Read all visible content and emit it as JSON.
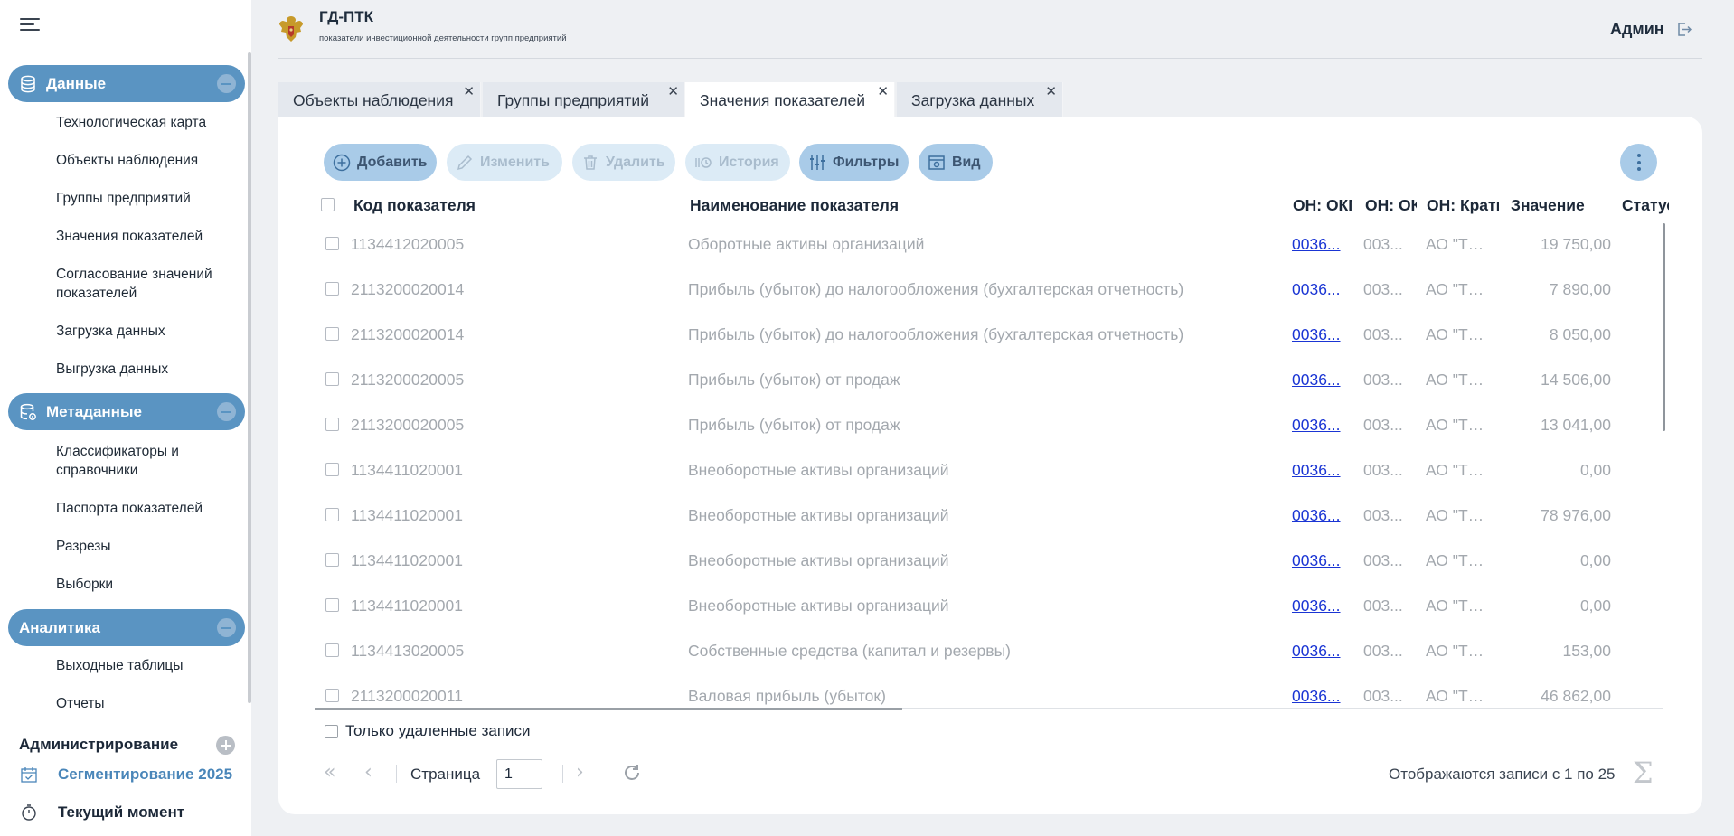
{
  "app": {
    "title": "ГД-ПТК",
    "subtitle": "показатели инвестиционной деятельности групп предприятий",
    "user": "Админ"
  },
  "sidebar": {
    "sections": [
      {
        "label": "Данные",
        "icon": "database-icon",
        "items": [
          "Технологическая карта",
          "Объекты наблюдения",
          "Группы предприятий",
          "Значения показателей",
          "Согласование значений показателей",
          "Загрузка данных",
          "Выгрузка данных"
        ]
      },
      {
        "label": "Метаданные",
        "icon": "database-settings-icon",
        "items": [
          "Классификаторы и справочники",
          "Паспорта показателей",
          "Разрезы",
          "Выборки"
        ]
      },
      {
        "label": "Аналитика",
        "icon": "",
        "items": [
          "Выходные таблицы",
          "Отчеты"
        ]
      }
    ],
    "admin_label": "Администрирование",
    "segment_label": "Сегментирование 2025",
    "now_label": "Текущий момент"
  },
  "tabs": [
    {
      "label": "Объекты наблюдения",
      "active": false
    },
    {
      "label": "Группы предприятий",
      "active": false
    },
    {
      "label": "Значения показателей",
      "active": true
    },
    {
      "label": "Загрузка данных",
      "active": false
    }
  ],
  "toolbar": {
    "add": "Добавить",
    "edit": "Изменить",
    "delete": "Удалить",
    "history": "История",
    "filters": "Фильтры",
    "view": "Вид"
  },
  "grid": {
    "columns": [
      "Код показателя",
      "Наименование показателя",
      "ОН: ОКПО",
      "ОН: ОКПО",
      "ОН: Краткое",
      "Значение",
      "Статус"
    ],
    "rows": [
      {
        "code": "1134412020005",
        "name": "Оборотные активы организаций",
        "okpo": "0036...",
        "okpo2": "003...",
        "short": "АО \"ТХ...",
        "value": "19 750,00"
      },
      {
        "code": "2113200020014",
        "name": "Прибыль (убыток) до налогообложения (бухгалтерская отчетность)",
        "okpo": "0036...",
        "okpo2": "003...",
        "short": "АО \"ТХ...",
        "value": "7 890,00"
      },
      {
        "code": "2113200020014",
        "name": "Прибыль (убыток) до налогообложения (бухгалтерская отчетность)",
        "okpo": "0036...",
        "okpo2": "003...",
        "short": "АО \"ТХ...",
        "value": "8 050,00"
      },
      {
        "code": "2113200020005",
        "name": "Прибыль (убыток) от продаж",
        "okpo": "0036...",
        "okpo2": "003...",
        "short": "АО \"ТХ...",
        "value": "14 506,00"
      },
      {
        "code": "2113200020005",
        "name": "Прибыль (убыток) от продаж",
        "okpo": "0036...",
        "okpo2": "003...",
        "short": "АО \"ТХ...",
        "value": "13 041,00"
      },
      {
        "code": "1134411020001",
        "name": "Внеоборотные активы организаций",
        "okpo": "0036...",
        "okpo2": "003...",
        "short": "АО \"ТХ...",
        "value": "0,00"
      },
      {
        "code": "1134411020001",
        "name": "Внеоборотные активы организаций",
        "okpo": "0036...",
        "okpo2": "003...",
        "short": "АО \"ТХ...",
        "value": "78 976,00"
      },
      {
        "code": "1134411020001",
        "name": "Внеоборотные активы организаций",
        "okpo": "0036...",
        "okpo2": "003...",
        "short": "АО \"ТХ...",
        "value": "0,00"
      },
      {
        "code": "1134411020001",
        "name": "Внеоборотные активы организаций",
        "okpo": "0036...",
        "okpo2": "003...",
        "short": "АО \"ТХ...",
        "value": "0,00"
      },
      {
        "code": "1134413020005",
        "name": "Собственные средства (капитал и резервы)",
        "okpo": "0036...",
        "okpo2": "003...",
        "short": "АО \"ТХ...",
        "value": "153,00"
      },
      {
        "code": "2113200020011",
        "name": "Валовая прибыль (убыток)",
        "okpo": "0036...",
        "okpo2": "003...",
        "short": "АО \"ТХ...",
        "value": "46 862,00"
      }
    ],
    "deleted_only_label": "Только удаленные записи"
  },
  "pagination": {
    "page_label": "Страница",
    "page": "1",
    "info": "Отображаются записи с 1 по 25"
  },
  "colors": {
    "accent": "#5a94c2",
    "button": "#a9cbe8",
    "link": "#1a35d4"
  }
}
